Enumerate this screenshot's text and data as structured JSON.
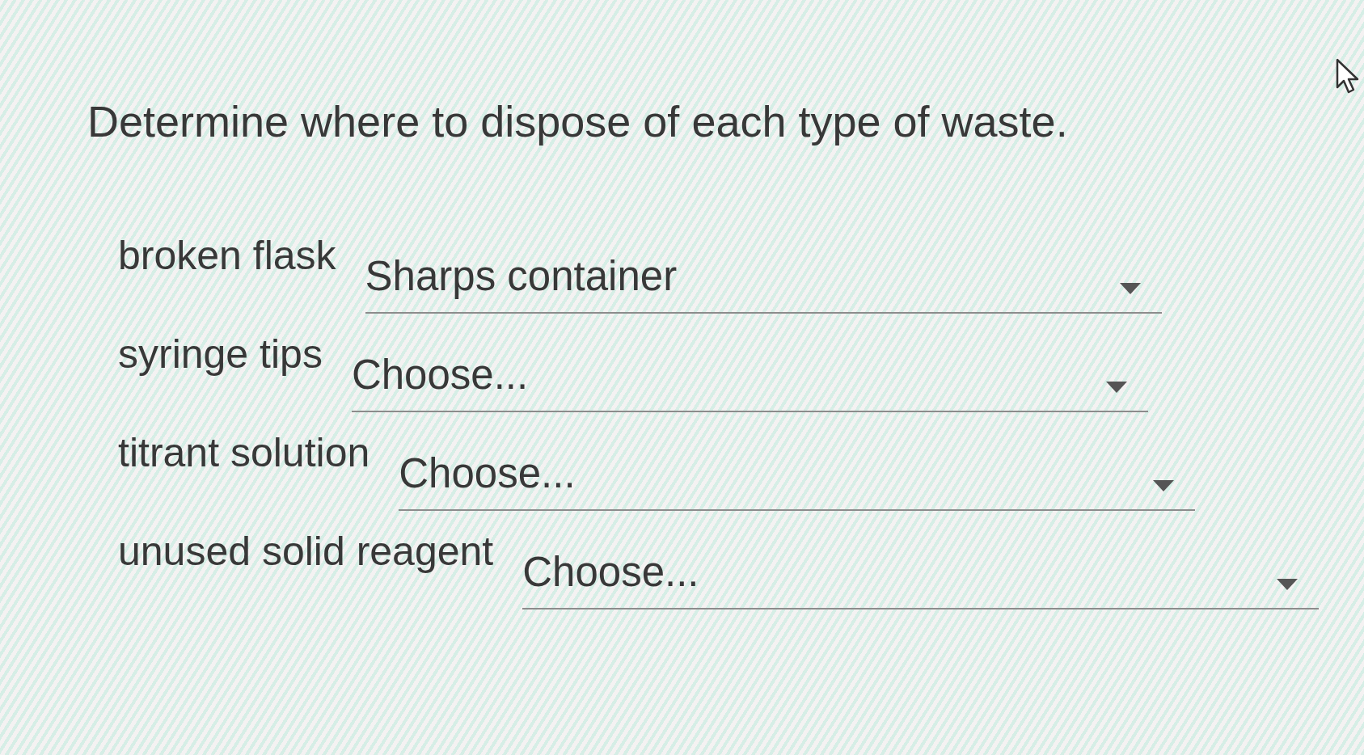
{
  "question": "Determine where to dispose of each type of waste.",
  "items": [
    {
      "label": "broken flask",
      "value": "Sharps container"
    },
    {
      "label": "syringe tips",
      "value": "Choose..."
    },
    {
      "label": "titrant solution",
      "value": "Choose..."
    },
    {
      "label": "unused solid reagent",
      "value": "Choose..."
    }
  ]
}
